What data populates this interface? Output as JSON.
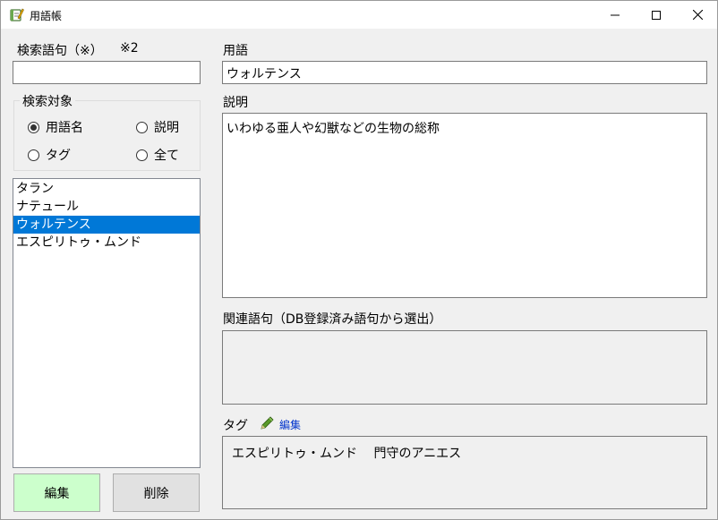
{
  "window": {
    "title": "用語帳",
    "icons": {
      "app": "notebook-icon",
      "minimize": "minimize-icon",
      "maximize": "maximize-icon",
      "close": "close-icon"
    }
  },
  "search": {
    "label": "検索語句（※）",
    "note": "※2",
    "value": "",
    "target": {
      "legend": "検索対象",
      "options": [
        {
          "label": "用語名",
          "checked": true
        },
        {
          "label": "説明",
          "checked": false
        },
        {
          "label": "タグ",
          "checked": false
        },
        {
          "label": "全て",
          "checked": false
        }
      ]
    }
  },
  "terms": {
    "items": [
      "タラン",
      "ナテュール",
      "ウォルテンス",
      "エスピリトゥ・ムンド"
    ],
    "selected_index": 2
  },
  "buttons": {
    "edit": "編集",
    "delete": "削除"
  },
  "detail": {
    "term_label": "用語",
    "term_value": "ウォルテンス",
    "desc_label": "説明",
    "desc_value": "いわゆる亜人や幻獣などの生物の総称",
    "related_label": "関連語句（DB登録済み語句から選出）",
    "related_value": "",
    "tag_label": "タグ",
    "tag_edit_icon": "pencil-icon",
    "tag_edit_label": "編集",
    "tags_value": "エスピリトゥ・ムンド　 門守のアニエス"
  },
  "colors": {
    "selection": "#0078d7",
    "edit_button": "#ccffcc",
    "link": "#0033cc"
  }
}
